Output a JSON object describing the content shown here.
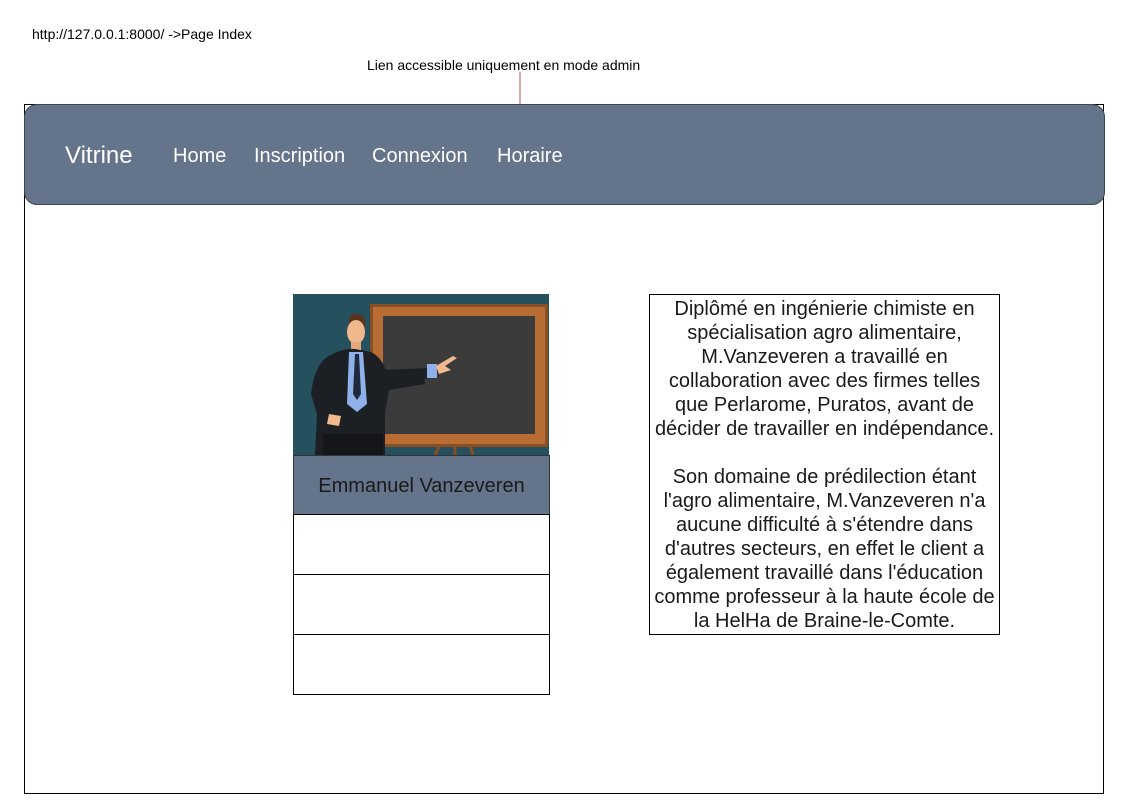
{
  "annotations": {
    "url": "http://127.0.0.1:8000/ ->Page Index",
    "admin_note": "Lien accessible uniquement en mode admin"
  },
  "navbar": {
    "brand": "Vitrine",
    "links": [
      {
        "label": "Home"
      },
      {
        "label": "Inscription"
      },
      {
        "label": "Connexion"
      },
      {
        "label": "Horaire"
      }
    ]
  },
  "profile_card": {
    "name": "Emmanuel Vanzeveren",
    "image": "teacher-at-blackboard-illustration",
    "rows": [
      "",
      "",
      ""
    ]
  },
  "bio": {
    "paragraph_1": "Diplômé en ingénierie chimiste en spécialisation agro alimentaire, M.Vanzeveren a travaillé en collaboration avec des firmes telles que Perlarome, Puratos, avant de décider de travailler en indépendance.",
    "paragraph_2": "Son domaine de prédilection étant l'agro alimentaire, M.Vanzeveren n'a aucune difficulté à s'étendre dans d'autres secteurs, en effet le client a également travaillé dans l'éducation comme professeur à la haute école de la HelHa de Braine-le-Comte."
  },
  "colors": {
    "navbar": "#64748a",
    "annotation_arrow": "#b85450",
    "text": "#1a1a1a"
  }
}
